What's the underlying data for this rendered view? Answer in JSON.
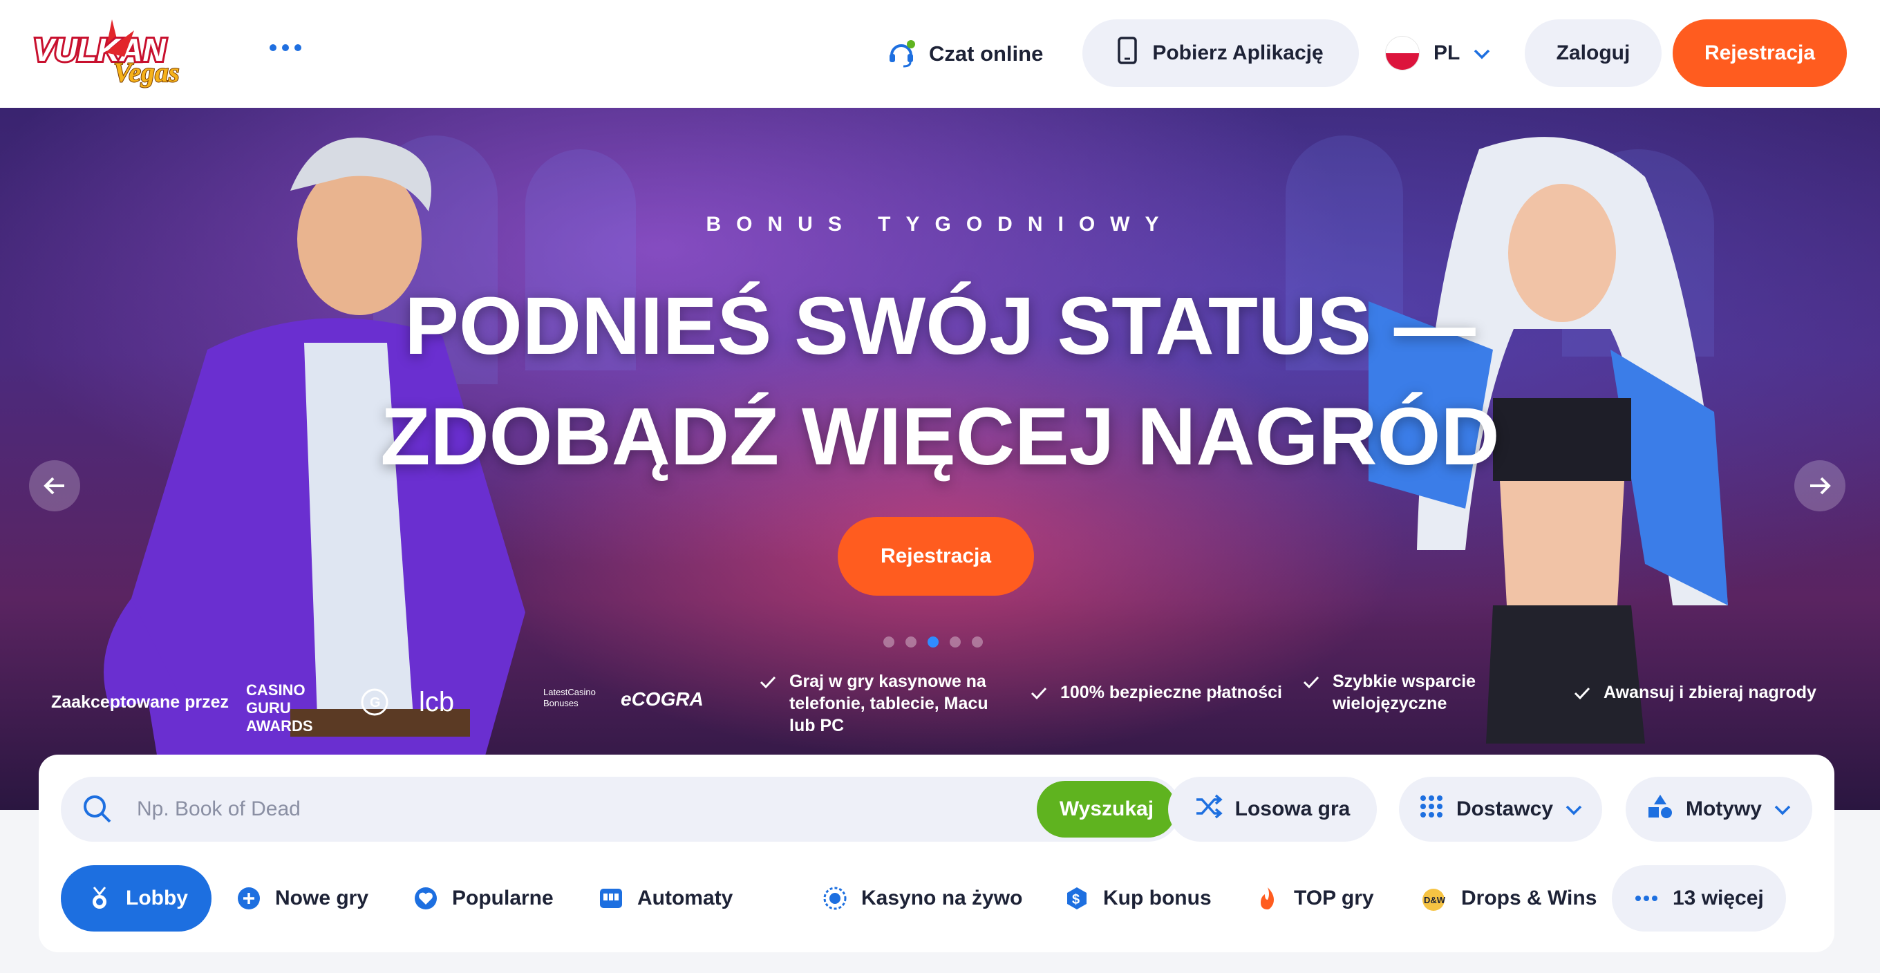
{
  "header": {
    "logo_text": "VULKAN Vegas",
    "chat_label": "Czat online",
    "app_label": "Pobierz Aplikację",
    "language": "PL",
    "login_label": "Zaloguj",
    "register_label": "Rejestracja"
  },
  "hero": {
    "eyebrow": "BONUS TYGODNIOWY",
    "title_line1": "PODNIEŚ SWÓJ STATUS —",
    "title_line2": "ZDOBĄDŹ WIĘCEJ NAGRÓD",
    "cta_label": "Rejestracja",
    "slide_count": 5,
    "active_slide": 3
  },
  "trust": {
    "accepted_by": "Zaakceptowane przez",
    "badges": [
      "CASINO GURU AWARDS",
      "lcb",
      "LatestCasino Bonuses",
      "eCOGRA"
    ],
    "features": [
      "Graj w gry kasynowe na telefonie, tablecie, Macu lub PC",
      "100% bezpieczne płatności",
      "Szybkie wsparcie wielojęzyczne",
      "Awansuj i zbieraj nagrody"
    ]
  },
  "search": {
    "placeholder": "Np. Book of Dead",
    "value": "",
    "button_label": "Wyszukaj"
  },
  "tools": {
    "random_label": "Losowa gra",
    "providers_label": "Dostawcy",
    "themes_label": "Motywy"
  },
  "categories": [
    {
      "label": "Lobby",
      "icon": "medal-icon",
      "active": true
    },
    {
      "label": "Nowe gry",
      "icon": "plus-circle-icon",
      "active": false
    },
    {
      "label": "Popularne",
      "icon": "heart-icon",
      "active": false
    },
    {
      "label": "Automaty",
      "icon": "slot-machine-icon",
      "active": false
    },
    {
      "label": "Kasyno na żywo",
      "icon": "live-icon",
      "active": false
    },
    {
      "label": "Kup bonus",
      "icon": "dollar-icon",
      "active": false
    },
    {
      "label": "TOP gry",
      "icon": "flame-icon",
      "active": false
    },
    {
      "label": "Drops & Wins",
      "icon": "drops-wins-icon",
      "active": false
    },
    {
      "label": "13 więcej",
      "icon": "more-dots-icon",
      "active": false
    }
  ],
  "colors": {
    "accent_orange": "#ff5c1f",
    "accent_blue": "#1d6fe0",
    "search_green": "#5fb31f"
  }
}
